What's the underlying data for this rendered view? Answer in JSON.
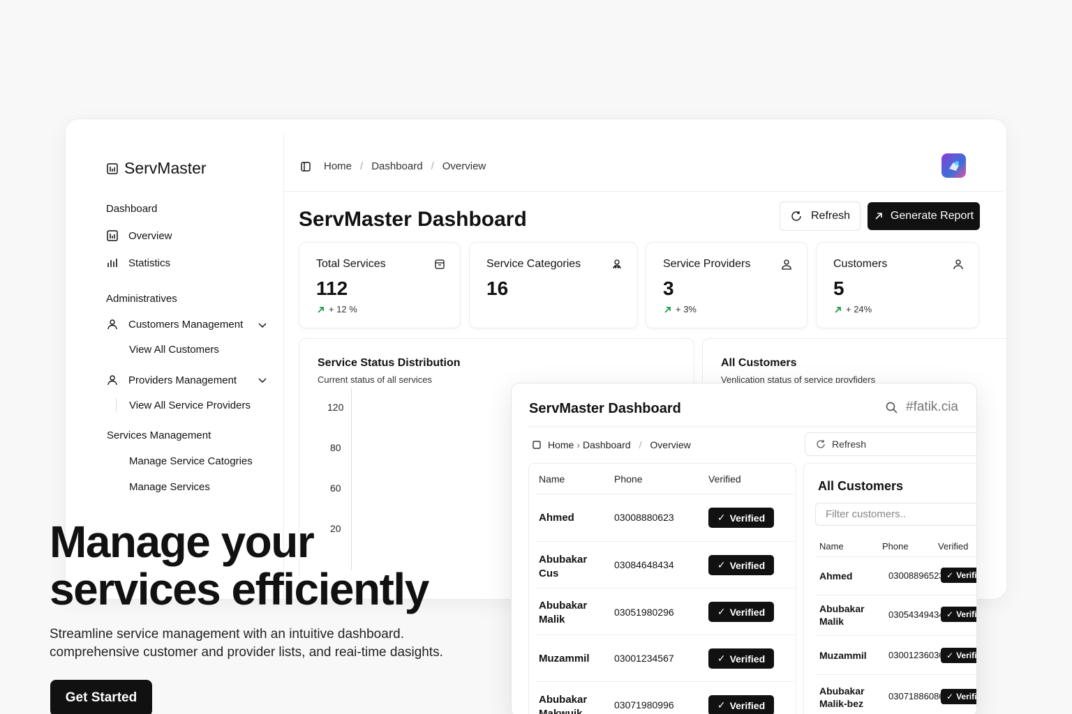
{
  "app": {
    "name": "ServMaster"
  },
  "sidebar": {
    "section_dashboard": "Dashboard",
    "overview": "Overview",
    "statistics": "Statistics",
    "section_admin": "Administratives",
    "customers_mgmt": "Customers Management",
    "view_customers": "View All Customers",
    "providers_mgmt": "Providers Management",
    "view_providers": "View All Service Providers",
    "section_services": "Services Management",
    "manage_categories": "Manage Service Catogries",
    "manage_services": "Manage Services"
  },
  "breadcrumb": [
    "Home",
    "Dashboard",
    "Overview"
  ],
  "header": {
    "title": "ServMaster Dashboard",
    "refresh_label": "Refresh",
    "report_label": "Generate Report"
  },
  "stats": [
    {
      "label": "Total Services",
      "value": "112",
      "trend": "+ 12 %",
      "icon": "archive-icon"
    },
    {
      "label": "Service Categories",
      "value": "16",
      "trend": "",
      "icon": "users-icon"
    },
    {
      "label": "Service Providers",
      "value": "3",
      "trend": "+ 3%",
      "icon": "user-icon"
    },
    {
      "label": "Customers",
      "value": "5",
      "trend": "+ 24%",
      "icon": "user-icon"
    }
  ],
  "status_panel": {
    "title": "Service Status Distribution",
    "subtitle": "Current status of all services",
    "yticks": [
      "120",
      "80",
      "60",
      "20"
    ]
  },
  "customers_panel": {
    "title": "All Customers",
    "subtitle": "Venlication status of service provfiders"
  },
  "hero": {
    "line1": "Manage your",
    "line2": "services efficiently",
    "sub1": "Streamline service management with an intuitive dashboard.",
    "sub2": "comprehensive customer and provider lists, and reai-time dasights.",
    "cta": "Get Started"
  },
  "overlay": {
    "title": "ServMaster Dashboard",
    "search_text": "#fatik.cia",
    "crumb_home": "Home",
    "crumb_dashboard": "Dashboard",
    "crumb_overview": "Overview",
    "refresh_label": "Refresh",
    "table": {
      "headers": [
        "Name",
        "Phone",
        "Verified"
      ],
      "rows": [
        {
          "name": "Ahmed",
          "phone": "03008880623",
          "status": "Verified"
        },
        {
          "name": "Abubakar Cus",
          "phone": "03084648434",
          "status": "Verified"
        },
        {
          "name": "Abubakar Malik",
          "phone": "03051980296",
          "status": "Verified"
        },
        {
          "name": "Muzammil",
          "phone": "03001234567",
          "status": "Verified"
        },
        {
          "name": "Abubakar Makwuik",
          "phone": "03071980996",
          "status": "Verified"
        }
      ]
    },
    "side_table": {
      "title": "All Customers",
      "filter_placeholder": "Filter customers..",
      "headers": [
        "Name",
        "Phone",
        "Verified"
      ],
      "rows": [
        {
          "name": "Ahmed",
          "phone": "03008896523",
          "status": "Verified"
        },
        {
          "name": "Abubakar Malik",
          "phone": "03054349434",
          "status": "Verified"
        },
        {
          "name": "Muzammil",
          "phone": "03001236036",
          "status": "Verified"
        },
        {
          "name": "Abubakar Malik-bez",
          "phone": "03071886086",
          "status": "Verified"
        }
      ]
    }
  },
  "colors": {
    "trend_green": "#1a9e4b",
    "primary": "#111111"
  }
}
